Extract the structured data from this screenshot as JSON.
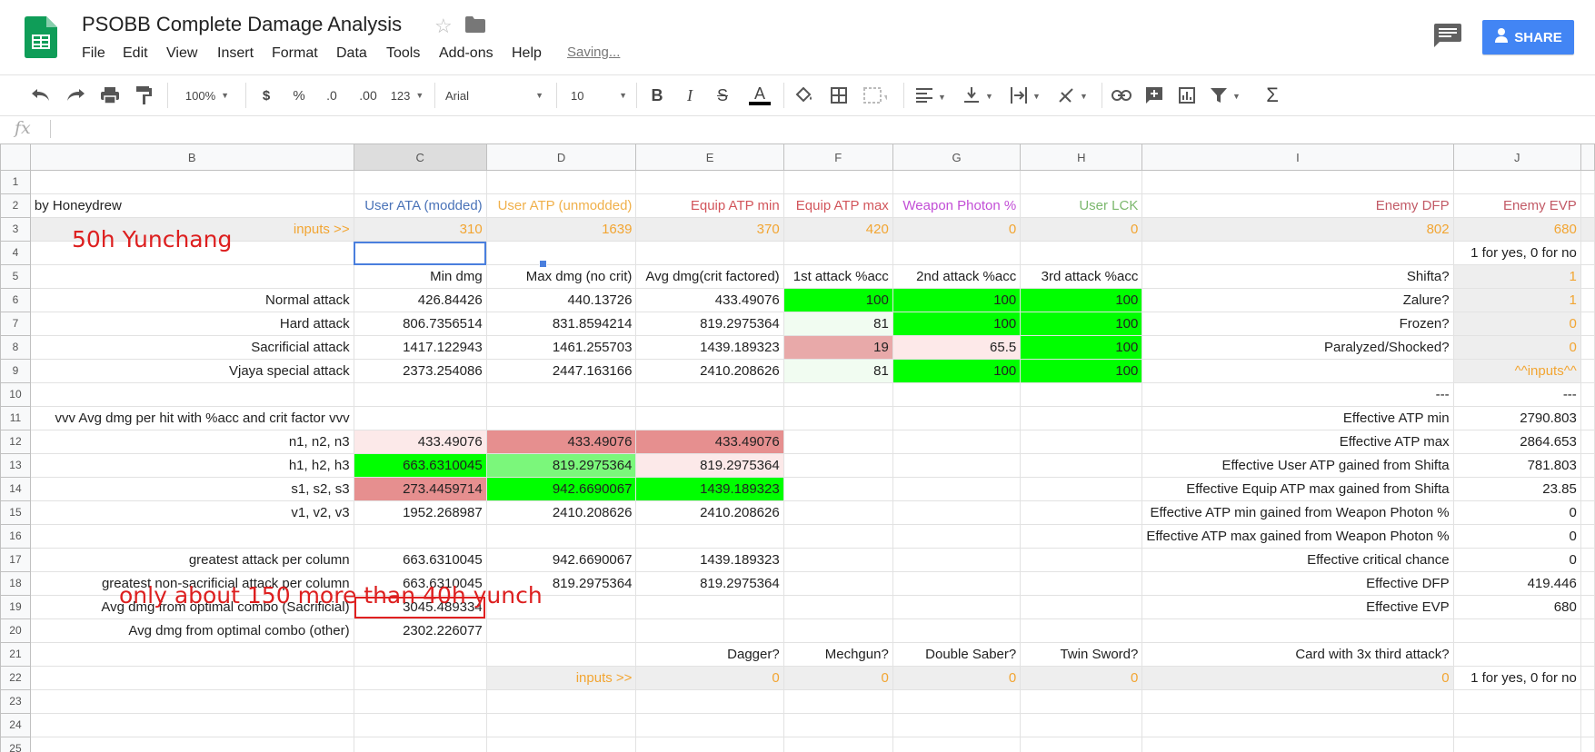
{
  "app": {
    "title": "PSOBB Complete Damage Analysis",
    "menu": [
      "File",
      "Edit",
      "View",
      "Insert",
      "Format",
      "Data",
      "Tools",
      "Add-ons",
      "Help"
    ],
    "saving": "Saving...",
    "share": "SHARE"
  },
  "toolbar": {
    "zoom": "100%",
    "currency": "$",
    "percent": "%",
    "dec_less": ".0",
    "dec_more": ".00",
    "more_formats": "123",
    "font": "Arial",
    "size": "10",
    "bold": "B",
    "italic": "I",
    "strike": "S",
    "textcolor": "A"
  },
  "formula_bar": {
    "fx": "fx",
    "value": ""
  },
  "columns": [
    "B",
    "C",
    "D",
    "E",
    "F",
    "G",
    "H",
    "I",
    "J"
  ],
  "row_numbers": [
    "1",
    "2",
    "3",
    "4",
    "5",
    "6",
    "7",
    "8",
    "9",
    "10",
    "11",
    "12",
    "13",
    "14",
    "15",
    "16",
    "17",
    "18",
    "19",
    "20",
    "21",
    "22",
    "23",
    "24",
    "25"
  ],
  "cells": {
    "r2": [
      "by Honeydrew",
      "User ATA (modded)",
      "User ATP (unmodded)",
      "Equip ATP min",
      "Equip ATP max",
      "Weapon Photon %",
      "User LCK",
      "Enemy DFP",
      "Enemy EVP"
    ],
    "r3": [
      "inputs >>",
      "310",
      "1639",
      "370",
      "420",
      "0",
      "0",
      "802",
      "680"
    ],
    "r4": [
      "",
      "",
      "",
      "",
      "",
      "",
      "",
      "",
      "1 for yes, 0 for no"
    ],
    "r5": [
      "",
      "Min dmg",
      "Max dmg (no crit)",
      "Avg dmg(crit factored)",
      "1st attack %acc",
      "2nd attack %acc",
      "3rd attack %acc",
      "Shifta?",
      "1"
    ],
    "r6": [
      "Normal attack",
      "426.84426",
      "440.13726",
      "433.49076",
      "100",
      "100",
      "100",
      "Zalure?",
      "1"
    ],
    "r7": [
      "Hard attack",
      "806.7356514",
      "831.8594214",
      "819.2975364",
      "81",
      "100",
      "100",
      "Frozen?",
      "0"
    ],
    "r8": [
      "Sacrificial attack",
      "1417.122943",
      "1461.255703",
      "1439.189323",
      "19",
      "65.5",
      "100",
      "Paralyzed/Shocked?",
      "0"
    ],
    "r9": [
      "Vjaya special attack",
      "2373.254086",
      "2447.163166",
      "2410.208626",
      "81",
      "100",
      "100",
      "",
      "^^inputs^^"
    ],
    "r10": [
      "",
      "",
      "",
      "",
      "",
      "",
      "",
      "---",
      "---"
    ],
    "r11": [
      "vvv Avg dmg per hit with %acc and crit factor vvv",
      "",
      "",
      "",
      "",
      "",
      "",
      "Effective ATP min",
      "2790.803"
    ],
    "r12": [
      "n1, n2, n3",
      "433.49076",
      "433.49076",
      "433.49076",
      "",
      "",
      "",
      "Effective ATP max",
      "2864.653"
    ],
    "r13": [
      "h1, h2, h3",
      "663.6310045",
      "819.2975364",
      "819.2975364",
      "",
      "",
      "",
      "Effective User ATP gained from Shifta",
      "781.803"
    ],
    "r14": [
      "s1, s2, s3",
      "273.4459714",
      "942.6690067",
      "1439.189323",
      "",
      "",
      "",
      "Effective Equip ATP max gained from Shifta",
      "23.85"
    ],
    "r15": [
      "v1, v2, v3",
      "1952.268987",
      "2410.208626",
      "2410.208626",
      "",
      "",
      "",
      "Effective ATP min gained from Weapon Photon %",
      "0"
    ],
    "r16": [
      "",
      "",
      "",
      "",
      "",
      "",
      "",
      "Effective ATP max gained from Weapon Photon %",
      "0"
    ],
    "r17": [
      "greatest attack per column",
      "663.6310045",
      "942.6690067",
      "1439.189323",
      "",
      "",
      "",
      "Effective critical chance",
      "0"
    ],
    "r18": [
      "greatest non-sacrificial attack per column",
      "663.6310045",
      "819.2975364",
      "819.2975364",
      "",
      "",
      "",
      "Effective DFP",
      "419.446"
    ],
    "r19": [
      "Avg dmg from optimal combo (Sacrificial)",
      "3045.489334",
      "",
      "",
      "",
      "",
      "",
      "Effective EVP",
      "680"
    ],
    "r20": [
      "Avg dmg from optimal combo (other)",
      "2302.226077",
      "",
      "",
      "",
      "",
      "",
      "",
      ""
    ],
    "r21": [
      "",
      "",
      "",
      "Dagger?",
      "Mechgun?",
      "Double Saber?",
      "Twin Sword?",
      "Card with 3x third attack?",
      ""
    ],
    "r22": [
      "",
      "",
      "inputs >>",
      "0",
      "0",
      "0",
      "0",
      "0",
      "1 for yes, 0 for no"
    ]
  },
  "annotations": {
    "a1": "50h Yunchang",
    "a2": "only about 150 more than 40h yunch"
  }
}
